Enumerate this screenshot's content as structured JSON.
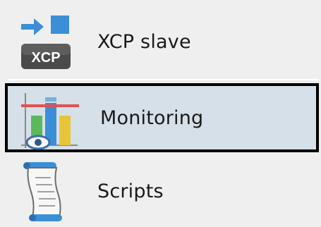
{
  "items": [
    {
      "label": "XCP slave",
      "icon": "xcp-slave-icon",
      "icon_text": "XCP",
      "selected": false
    },
    {
      "label": "Monitoring",
      "icon": "monitoring-chart-icon",
      "selected": true
    },
    {
      "label": "Scripts",
      "icon": "scroll-icon",
      "selected": false
    }
  ],
  "colors": {
    "selected_bg": "#d5e0e8",
    "selected_border": "#000000",
    "panel_bg": "#efefef",
    "accent_blue": "#3a8fd6"
  }
}
